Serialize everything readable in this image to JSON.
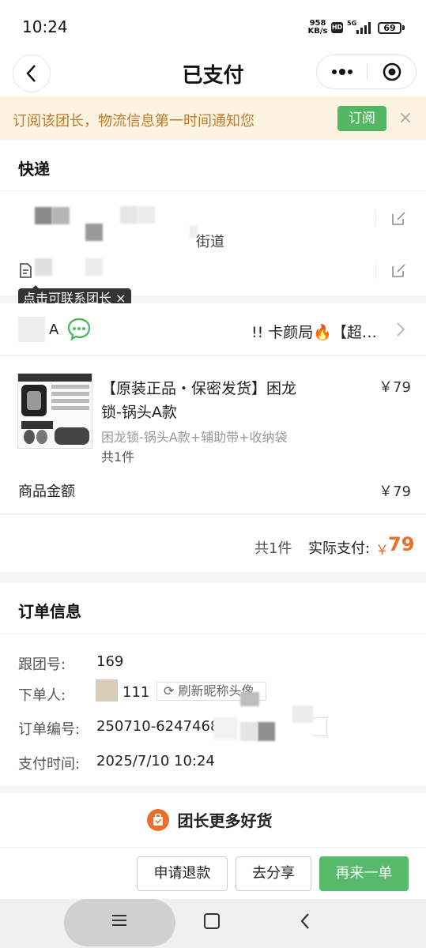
{
  "status_bar": {
    "time": "10:24",
    "net_speed_value": "958",
    "net_speed_unit": "KB/s",
    "hd": "HD",
    "network": "5G",
    "battery": "69"
  },
  "nav": {
    "title": "已支付",
    "icons": {
      "back": "chevron-left-icon",
      "more": "more-dots-icon",
      "close": "target-circle-icon"
    }
  },
  "subscribe": {
    "text": "订阅该团长，物流信息第一时间通知您",
    "button": "订阅",
    "close": "×"
  },
  "express": {
    "title": "快递",
    "street_fragment": "街道",
    "tooltip": "点击可联系团长 ×"
  },
  "leader": {
    "name_suffix": "A",
    "shop_name": "!! 卡颜局🔥【超…"
  },
  "product": {
    "name": "【原装正品・保密发货】困龙锁-锅头A款",
    "price": "￥79",
    "spec": "困龙锁-锅头A款+辅助带+收纳袋",
    "quantity": "共1件"
  },
  "summary": {
    "goods_amount_label": "商品金额",
    "goods_amount": "￥79",
    "total_count": "共1件",
    "paid_label": "实际支付:",
    "paid_currency": "￥",
    "paid_amount": "79"
  },
  "order_info": {
    "title": "订单信息",
    "follow_no_label": "跟团号:",
    "follow_no": "169",
    "buyer_label": "下单人:",
    "buyer": "111",
    "refresh_button": "刷新昵称头像",
    "order_no_label": "订单编号:",
    "order_no": "250710-6247468",
    "pay_time_label": "支付时间:",
    "pay_time": "2025/7/10 10:24"
  },
  "more_goods": "团长更多好货",
  "actions": {
    "refund": "申请退款",
    "share": "去分享",
    "reorder": "再来一单"
  },
  "colors": {
    "accent_green": "#53b662",
    "paid_orange": "#e8702a",
    "banner_bg": "#fdf3e1",
    "banner_text": "#c07a2b"
  }
}
